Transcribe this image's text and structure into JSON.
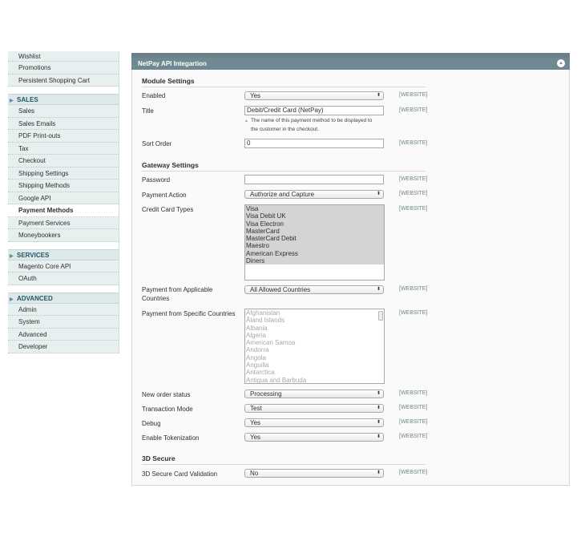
{
  "sidebar": {
    "top_items": [
      "Wishlist",
      "Promotions",
      "Persistent Shopping Cart"
    ],
    "groups": [
      {
        "title": "SALES",
        "items": [
          "Sales",
          "Sales Emails",
          "PDF Print-outs",
          "Tax",
          "Checkout",
          "Shipping Settings",
          "Shipping Methods",
          "Google API",
          "Payment Methods",
          "Payment Services",
          "Moneybookers"
        ],
        "active": "Payment Methods"
      },
      {
        "title": "SERVICES",
        "items": [
          "Magento Core API",
          "OAuth"
        ]
      },
      {
        "title": "ADVANCED",
        "items": [
          "Admin",
          "System",
          "Advanced",
          "Developer"
        ]
      }
    ]
  },
  "panel": {
    "title": "NetPay API Integartion",
    "scope_label": "[WEBSITE]"
  },
  "module_settings": {
    "title": "Module Settings",
    "enabled": {
      "label": "Enabled",
      "value": "Yes"
    },
    "title_field": {
      "label": "Title",
      "value": "Debit/Credit Card (NetPay)",
      "note_line1": "The name of this payment method to be displayed to",
      "note_line2": "the customer in the checkout."
    },
    "sort_order": {
      "label": "Sort Order",
      "value": "0"
    }
  },
  "gateway_settings": {
    "title": "Gateway Settings",
    "password": {
      "label": "Password",
      "value": ""
    },
    "payment_action": {
      "label": "Payment Action",
      "value": "Authorize and Capture"
    },
    "cc_types": {
      "label": "Credit Card Types",
      "options": [
        "Visa",
        "Visa Debit UK",
        "Visa Electron",
        "MasterCard",
        "MasterCard Debit",
        "Maestro",
        "American Express",
        "Diners"
      ]
    },
    "applicable_countries": {
      "label_line1": "Payment from Applicable",
      "label_line2": "Countries",
      "value": "All Allowed Countries"
    },
    "specific_countries": {
      "label": "Payment from Specific Countries",
      "options": [
        "Afghanistan",
        "Åland Islands",
        "Albania",
        "Algeria",
        "American Samoa",
        "Andorra",
        "Angola",
        "Anguilla",
        "Antarctica",
        "Antigua and Barbuda"
      ]
    },
    "order_status": {
      "label": "New order status",
      "value": "Processing"
    },
    "transaction_mode": {
      "label": "Transaction Mode",
      "value": "Test"
    },
    "debug": {
      "label": "Debug",
      "value": "Yes"
    },
    "tokenization": {
      "label": "Enable Tokenization",
      "value": "Yes"
    }
  },
  "secure3d": {
    "title": "3D Secure",
    "validation": {
      "label": "3D Secure Card Validation",
      "value": "No"
    }
  }
}
